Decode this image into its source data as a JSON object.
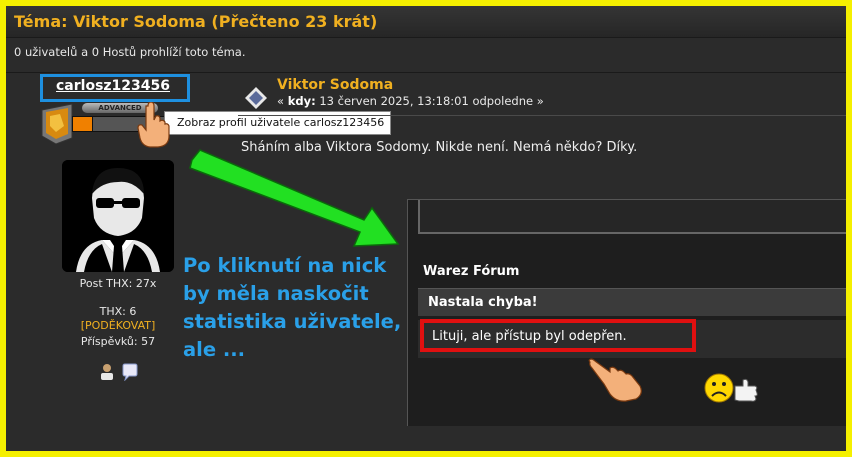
{
  "topic": {
    "title": "Téma: Viktor Sodoma  (Přečteno 23 krát)",
    "viewers": "0 uživatelů a 0 Hostů prohlíží toto téma."
  },
  "author": {
    "username": "carlosz123456",
    "rank_label": "ADVANCED",
    "tooltip": "Zobraz profil uživatele carlosz123456",
    "stats": {
      "post_thx": "Post THX: 27x",
      "thx": "THX: 6",
      "thank_link": "[PODĚKOVAT]",
      "posts": "Příspěvků: 57"
    }
  },
  "post": {
    "title": "Viktor Sodoma",
    "date_prefix": "« ",
    "date_label": "kdy:",
    "date_value": " 13 červen 2025, 13:18:01 odpoledne »",
    "body": "Sháním alba Viktora Sodomy. Nikde není. Nemá někdo? Díky."
  },
  "annotation": {
    "text_lines": [
      "Po kliknutí na nick",
      "by měla naskočit",
      "statistika uživatele,",
      "ale ..."
    ]
  },
  "error_page": {
    "forum_name": "Warez Fórum",
    "error_heading": "Nastala chyba!",
    "error_message": "Lituji, ale přístup byl odepřen."
  },
  "colors": {
    "outer_frame": "#f5f000",
    "accent_orange": "#f0b020",
    "highlight_blue": "#1e90e0",
    "arrow_green": "#22e022",
    "error_red": "#e01010"
  }
}
